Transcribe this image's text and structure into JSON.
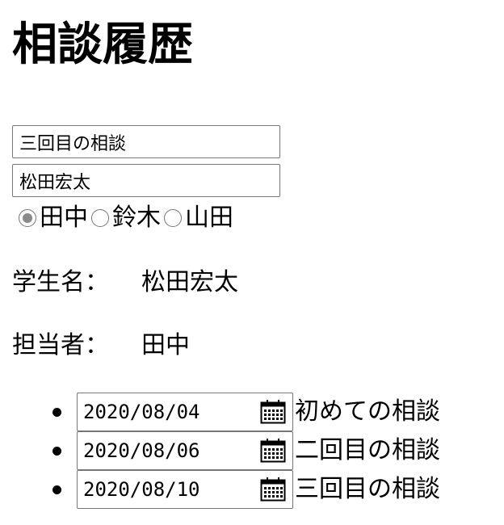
{
  "page": {
    "heading": "相談履歴"
  },
  "form": {
    "title_value": "三回目の相談",
    "student_value": "松田宏太",
    "staff_options": [
      {
        "label": "田中",
        "checked": true
      },
      {
        "label": "鈴木",
        "checked": false
      },
      {
        "label": "山田",
        "checked": false
      }
    ]
  },
  "info": {
    "student_label": "学生名：",
    "student_name": "松田宏太",
    "staff_label": "担当者：",
    "staff_name": "田中"
  },
  "history": [
    {
      "date": "2020/08/04",
      "title": "初めての相談"
    },
    {
      "date": "2020/08/06",
      "title": "二回目の相談"
    },
    {
      "date": "2020/08/10",
      "title": "三回目の相談"
    }
  ],
  "icons": {
    "calendar": "calendar-icon"
  },
  "colors": {
    "border": "#767676",
    "radio_checked": "#8a8a8a"
  }
}
